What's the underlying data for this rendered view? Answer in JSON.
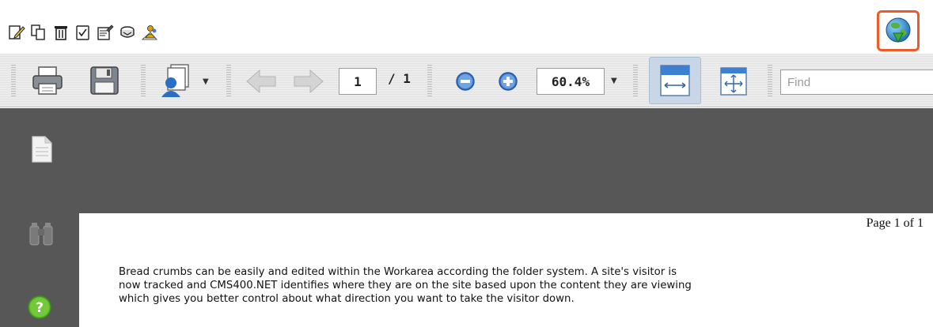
{
  "action_bar": {
    "icons": [
      "edit-icon",
      "copy-icon",
      "delete-icon",
      "checklist-icon",
      "properties-icon",
      "archive-icon",
      "approve-icon"
    ],
    "globe_icon": "globe-download-icon"
  },
  "toolbar": {
    "current_page": "1",
    "total_pages": "/ 1",
    "zoom": "60.4%",
    "find_placeholder": "Find"
  },
  "document": {
    "page_label": "Page 1 of 1",
    "lines": [
      "Bread crumbs can be easily  and edited within the Workarea according the folder system.  A site's visitor is",
      "now tracked and CMS400.NET identifies where they are on the site based upon the content they are viewing",
      "which gives you better control about what direction you want to take the visitor down."
    ]
  },
  "colors": {
    "accent_border": "#ee5a28",
    "document_background": "#575757"
  }
}
